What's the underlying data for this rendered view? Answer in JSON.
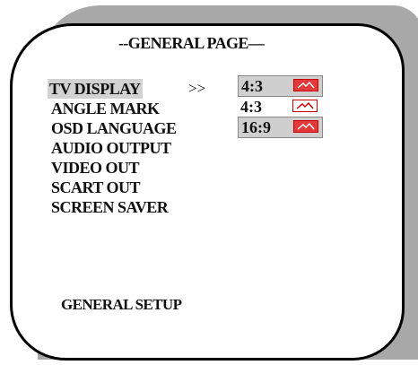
{
  "page": {
    "title": "--GENERAL PAGE—",
    "footer": "GENERAL SETUP",
    "selected_indicator": ">>"
  },
  "menu": {
    "items": [
      {
        "label": "TV DISPLAY",
        "selected": true
      },
      {
        "label": "ANGLE MARK"
      },
      {
        "label": "OSD LANGUAGE"
      },
      {
        "label": "AUDIO OUTPUT"
      },
      {
        "label": "VIDEO OUT"
      },
      {
        "label": "SCART OUT"
      },
      {
        "label": "SCREEN SAVER"
      }
    ]
  },
  "options": [
    {
      "label": "4:3",
      "icon": "picture-frame-icon",
      "highlighted": true
    },
    {
      "label": "4:3",
      "icon": "picture-frame-icon"
    },
    {
      "label": "16:9",
      "icon": "picture-frame-icon"
    }
  ],
  "colors": {
    "panel_shadow": "#a8a8a8",
    "selection": "#d2d2d2",
    "icon_red": "#cc0000"
  }
}
